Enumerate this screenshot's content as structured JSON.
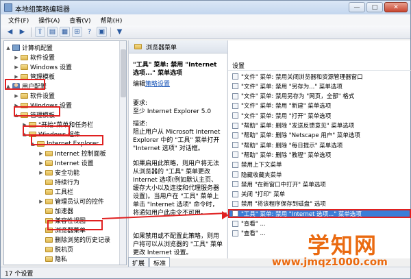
{
  "window": {
    "title": "本地组策略编辑器",
    "min": "—",
    "max": "□",
    "close": "✕"
  },
  "menubar": [
    "文件(F)",
    "操作(A)",
    "查看(V)",
    "帮助(H)"
  ],
  "tree": [
    {
      "label": "计算机配置",
      "depth": 1,
      "twisty": "▲"
    },
    {
      "label": "软件设置",
      "depth": 2,
      "twisty": "▶"
    },
    {
      "label": "Windows 设置",
      "depth": 2,
      "twisty": "▶"
    },
    {
      "label": "管理模板",
      "depth": 2,
      "twisty": "▶"
    },
    {
      "label": "用户配置",
      "depth": 1,
      "twisty": "▲"
    },
    {
      "label": "软件设置",
      "depth": 2,
      "twisty": "▶"
    },
    {
      "label": "Windows 设置",
      "depth": 2,
      "twisty": "▶"
    },
    {
      "label": "管理模板",
      "depth": 2,
      "twisty": "▲"
    },
    {
      "label": "\"开始\"菜单和任务栏",
      "depth": 3,
      "twisty": "▶"
    },
    {
      "label": "Windows 组件",
      "depth": 3,
      "twisty": "▲"
    },
    {
      "label": "Internet Explorer",
      "depth": 4,
      "twisty": "▲"
    },
    {
      "label": "Internet 控制面板",
      "depth": 5,
      "twisty": "▶"
    },
    {
      "label": "Internet 设置",
      "depth": 5,
      "twisty": "▶"
    },
    {
      "label": "安全功能",
      "depth": 5,
      "twisty": "▶"
    },
    {
      "label": "持续行为",
      "depth": 5,
      "twisty": ""
    },
    {
      "label": "工具栏",
      "depth": 5,
      "twisty": ""
    },
    {
      "label": "管理员认可的控件",
      "depth": 5,
      "twisty": "▶"
    },
    {
      "label": "加速器",
      "depth": 5,
      "twisty": ""
    },
    {
      "label": "兼容性视图",
      "depth": 5,
      "twisty": ""
    },
    {
      "label": "浏览器菜单",
      "depth": 5,
      "twisty": ""
    },
    {
      "label": "删除浏览的历史记录",
      "depth": 5,
      "twisty": ""
    },
    {
      "label": "脱机页",
      "depth": 5,
      "twisty": ""
    },
    {
      "label": "隐私",
      "depth": 5,
      "twisty": ""
    }
  ],
  "desc": {
    "caption": "浏览器菜单",
    "title": "\"工具\" 菜单: 禁用 \"Internet 选项...\" 菜单选项",
    "edit_prefix": "编辑",
    "edit_link": "策略设置",
    "req_label": "要求:",
    "req_text": "至少 Internet Explorer 5.0",
    "desc_label": "描述:",
    "p1": "阻止用户从 Microsoft Internet Explorer 中的 \"工具\" 菜单打开 \"Internet 选项\" 对话框。",
    "p2": "如果启用此策略，则用户将无法从浏览器的 \"工具\" 菜单更改 Internet 选项(例如默认主页、缓存大小以及连接和代理服务器设置)。当用户在 \"工具\" 菜单上单击 \"Internet 选项\" 命令时，将通知用户此命令不可用。",
    "p3": "如果禁用或不配置此策略，则用户将可以从浏览器的 \"工具\" 菜单更改 Internet 设置。"
  },
  "list": {
    "header": "设置",
    "rows": [
      "\"文件\" 菜单: 禁用关闭浏览器和资源管理器窗口",
      "\"文件\" 菜单: 禁用 \"另存为...\" 菜单选项",
      "\"文件\" 菜单: 禁用另存为 \"网页，全部\" 格式",
      "\"文件\" 菜单: 禁用 \"新建\" 菜单选项",
      "\"文件\" 菜单: 禁用 \"打开\" 菜单选项",
      "\"帮助\" 菜单: 删除 \"发送反馈意见\" 菜单选项",
      "\"帮助\" 菜单: 删除 \"Netscape 用户\" 菜单选项",
      "\"帮助\" 菜单: 删除 \"每日提示\" 菜单选项",
      "\"帮助\" 菜单: 删除 \"教程\" 菜单选项",
      "禁用上下文菜单",
      "隐藏收藏夹菜单",
      "禁用 \"在新窗口中打开\" 菜单选项",
      "关闭 \"打印\" 菜单",
      "禁用 \"将该程序保存到磁盘\" 选项",
      "\"工具\" 菜单: 禁用 \"Internet 选项...\" 菜单选项",
      "\"查看\" ...",
      "\"查看\" ..."
    ]
  },
  "tabs": [
    "扩展",
    "标准"
  ],
  "status": "17 个设置",
  "watermark": {
    "brand": "学知网",
    "url": "www.jmqz1000.com"
  }
}
